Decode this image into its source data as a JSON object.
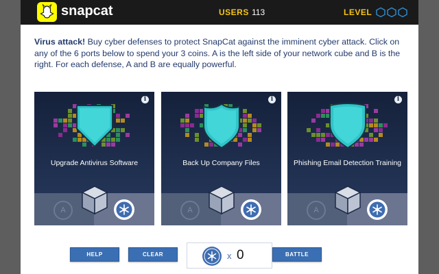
{
  "topbar": {
    "app_name": "snapcat",
    "users_label": "USERS",
    "users_count": "113",
    "level_label": "LEVEL",
    "level_filled": 0,
    "level_total": 3
  },
  "instructions": {
    "lead": "Virus attack!",
    "body": " Buy cyber defenses to protect SnapCat against the imminent cyber attack. Click on any of the 6 ports below to spend your 3 coins. A is the left side of your network cube and B is the right. For each defense, A and B are equally powerful."
  },
  "cards": [
    {
      "title": "Upgrade Antivirus Software",
      "port_a": "A",
      "info": "i"
    },
    {
      "title": "Back Up Company Files",
      "port_a": "A",
      "info": "i"
    },
    {
      "title": "Phishing Email Detection Training",
      "port_a": "A",
      "info": "i"
    }
  ],
  "controls": {
    "help_label": "HELP",
    "clear_label": "CLEAR",
    "coin_multiplier": "x",
    "coin_count": "0",
    "battle_label": "BATTLE"
  },
  "colors": {
    "accent_yellow": "#f5c518",
    "button_blue": "#3b6fb3",
    "card_navy": "#1c2a47",
    "shield_teal": "#2ec4c9"
  },
  "icons": {
    "logo": "snapcat-logo-icon",
    "level": "hexagon-icon",
    "info": "info-icon",
    "port_b": "snowflake-bug-icon",
    "cube": "network-cube-icon",
    "shield": "shield-icon"
  }
}
